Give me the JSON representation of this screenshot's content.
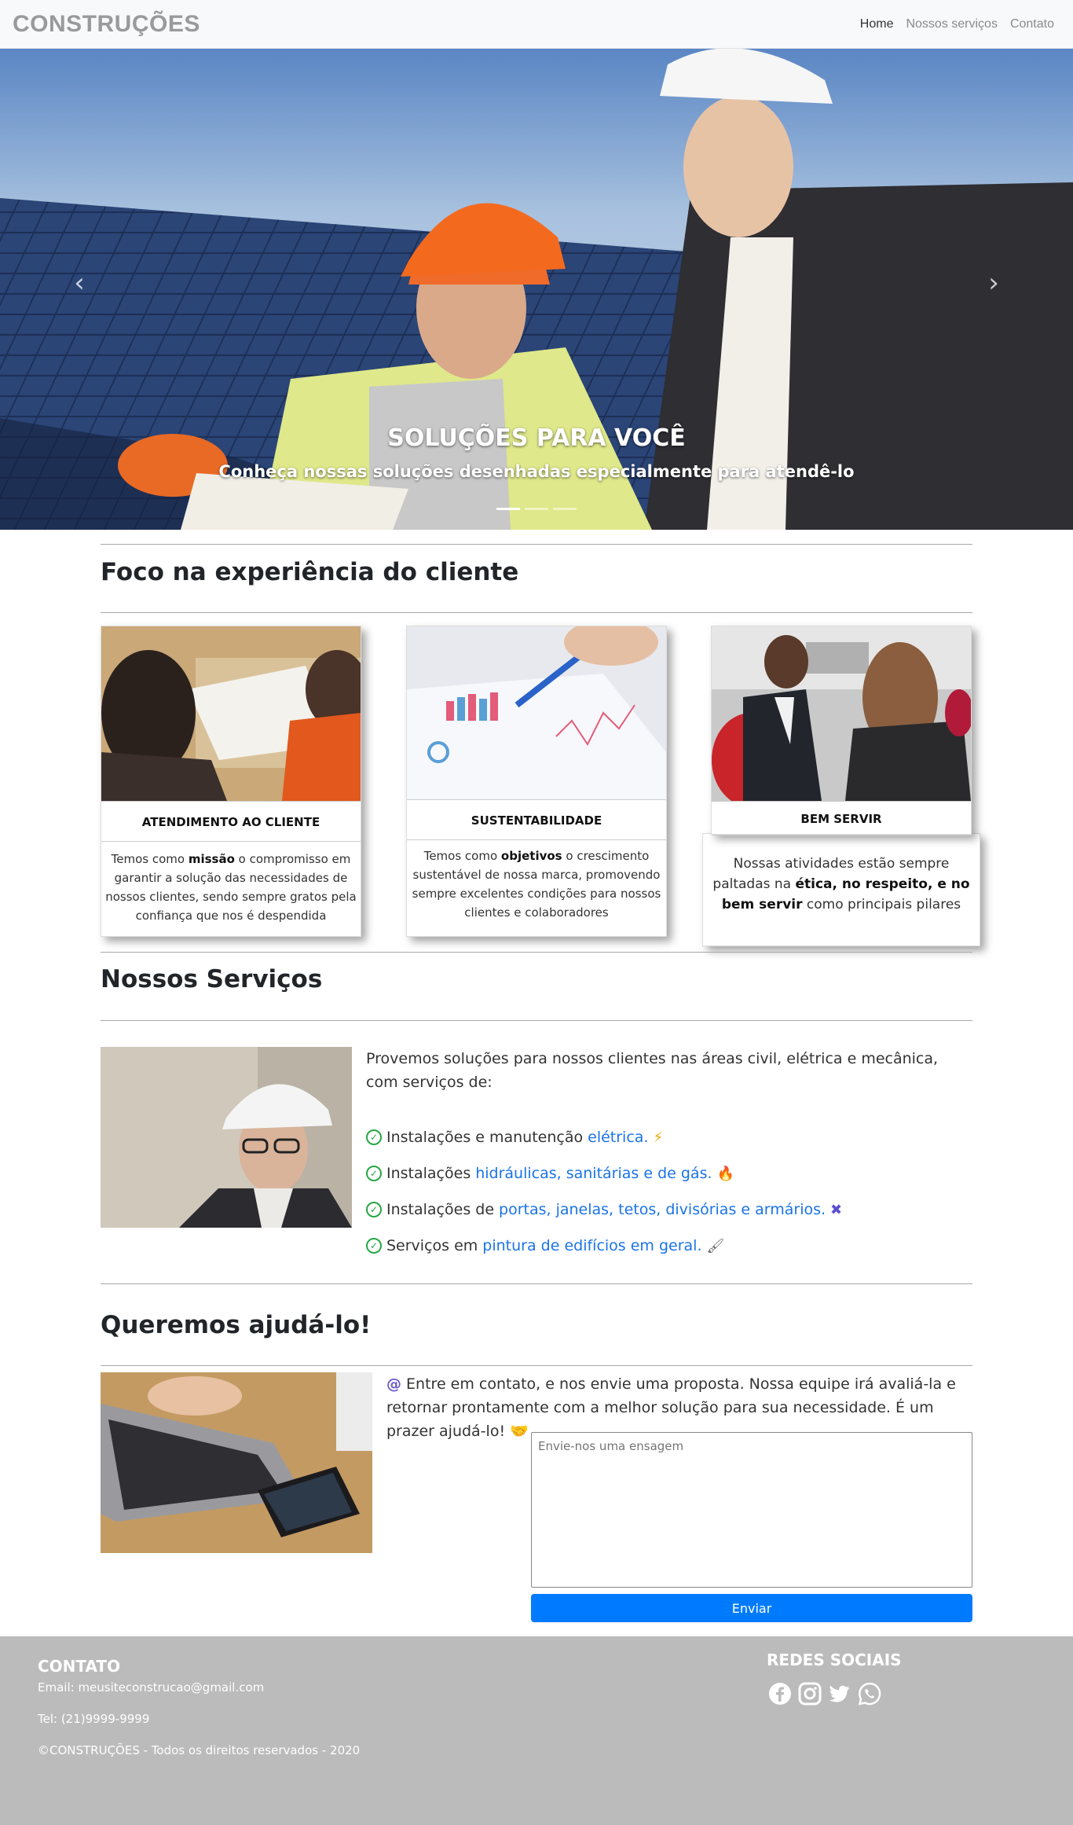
{
  "navbar": {
    "brand": "CONSTRUÇÕES",
    "links": [
      {
        "label": "Home",
        "active": true
      },
      {
        "label": "Nossos serviços",
        "active": false
      },
      {
        "label": "Contato",
        "active": false
      }
    ]
  },
  "hero": {
    "title": "SOLUÇÕES PARA VOCÊ",
    "subtitle": "Conheça nossas soluções desenhadas especialmente para atendê-lo",
    "prev_icon": "chevron-left-icon",
    "next_icon": "chevron-right-icon",
    "slide_count": 3,
    "active_slide": 1
  },
  "focus": {
    "title": "Foco na experiência do cliente",
    "cards": [
      {
        "title": "ATENDIMENTO AO CLIENTE",
        "text_before": "Temos como ",
        "text_bold": "missão",
        "text_after": " o compromisso em garantir a solução das necessidades de nossos clientes, sendo sempre gratos pela confiança que nos é despendida"
      },
      {
        "title": "SUSTENTABILIDADE",
        "text_before": "Temos como ",
        "text_bold": "objetivos",
        "text_after": " o crescimento sustentável de nossa marca, promovendo sempre excelentes condições para nossos clientes e colaboradores"
      },
      {
        "title": "BEM SERVIR",
        "text_before": "Nossas atividades estão sempre paltadas na ",
        "text_bold": "ética, no respeito, e no bem servir",
        "text_after": " como principais pilares"
      }
    ]
  },
  "services": {
    "title": "Nossos Serviços",
    "intro": "Provemos soluções para nossos clientes nas áreas civil, elétrica e mecânica, com serviços de:",
    "items": [
      {
        "prefix": "Instalações e manutenção ",
        "link": "elétrica.",
        "icon": "lightning-icon"
      },
      {
        "prefix": "Instalações ",
        "link": "hidráulicas, sanitárias e de gás.",
        "icon": "flame-icon"
      },
      {
        "prefix": "Instalações de ",
        "link": "portas, janelas, tetos, divisórias e armários.",
        "icon": "tools-icon"
      },
      {
        "prefix": "Serviços em ",
        "link": "pintura de edifícios em geral.",
        "icon": "paint-roller-icon"
      }
    ]
  },
  "contact": {
    "title": "Queremos ajudá-lo!",
    "text": "Entre em contato, e nos envie uma proposta. Nossa equipe irá avaliá-la e retornar prontamente com a melhor solução para sua necessidade. É um prazer ajudá-lo!",
    "textarea_placeholder": "Envie-nos uma ensagem",
    "send_label": "Enviar"
  },
  "footer": {
    "contact_title": "CONTATO",
    "email": "Email: meusiteconstrucao@gmail.com",
    "phone": "Tel: (21)9999-9999",
    "copyright": "©CONSTRUÇÕES - Todos os direitos reservados - 2020",
    "social_title": "REDES SOCIAIS",
    "social_icons": [
      "facebook-icon",
      "instagram-icon",
      "twitter-icon",
      "whatsapp-icon"
    ]
  },
  "colors": {
    "primary": "#007bff",
    "link": "#1a73e8",
    "check": "#28a745",
    "footer_bg": "#bbbbbb",
    "navbar_bg": "#f8f9fa"
  }
}
